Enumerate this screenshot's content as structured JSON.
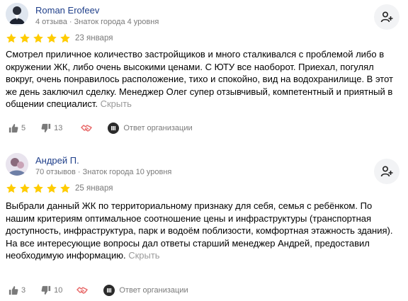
{
  "reviews": [
    {
      "author": "Roman Erofeev",
      "meta": "4 отзыва · Знаток города 4 уровня",
      "rating": 5,
      "date": "23 января",
      "text": "Смотрел приличное количество застройщиков и много сталкивался с проблемой либо в окружении ЖК, либо очень высокими ценами. С ЮТУ все наоборот. Приехал, погулял вокруг, очень понравилось расположение, тихо и спокойно, вид на водохранилище. В этот же день заключил сделку. Менеджер Олег супер отзывчивый, компетентный и приятный в общении специалист.",
      "hide_label": "Скрыть",
      "likes": "5",
      "dislikes": "13",
      "org_reply_label": "Ответ организации",
      "avatar_icon": "avatar-photo"
    },
    {
      "author": "Андрей П.",
      "meta": "70 отзывов · Знаток города 10 уровня",
      "rating": 5,
      "date": "25 января",
      "text": "Выбрали данный ЖК по территориальному признаку для себя, семья с ребёнком. По нашим критериям оптимальное соотношение цены и инфраструктуры (транспортная доступность, инфраструктура, парк и водоём поблизости, комфортная этажность здания).\nНа все интересующие вопросы дал ответы старший менеджер Андрей, предоставил необходимую информацию.",
      "hide_label": "Скрыть",
      "likes": "3",
      "dislikes": "10",
      "org_reply_label": "Ответ организации",
      "avatar_icon": "avatar-photo"
    }
  ],
  "colors": {
    "star": "#ffcc00",
    "author": "#1f3f8a",
    "muted": "#7a7a7a",
    "link_muted": "#9a9a9a",
    "thanks_icon": "#e86a6a"
  },
  "icons": [
    "add-user-icon",
    "star-icon",
    "thumb-up-icon",
    "thumb-down-icon",
    "handshake-icon",
    "organization-icon"
  ]
}
